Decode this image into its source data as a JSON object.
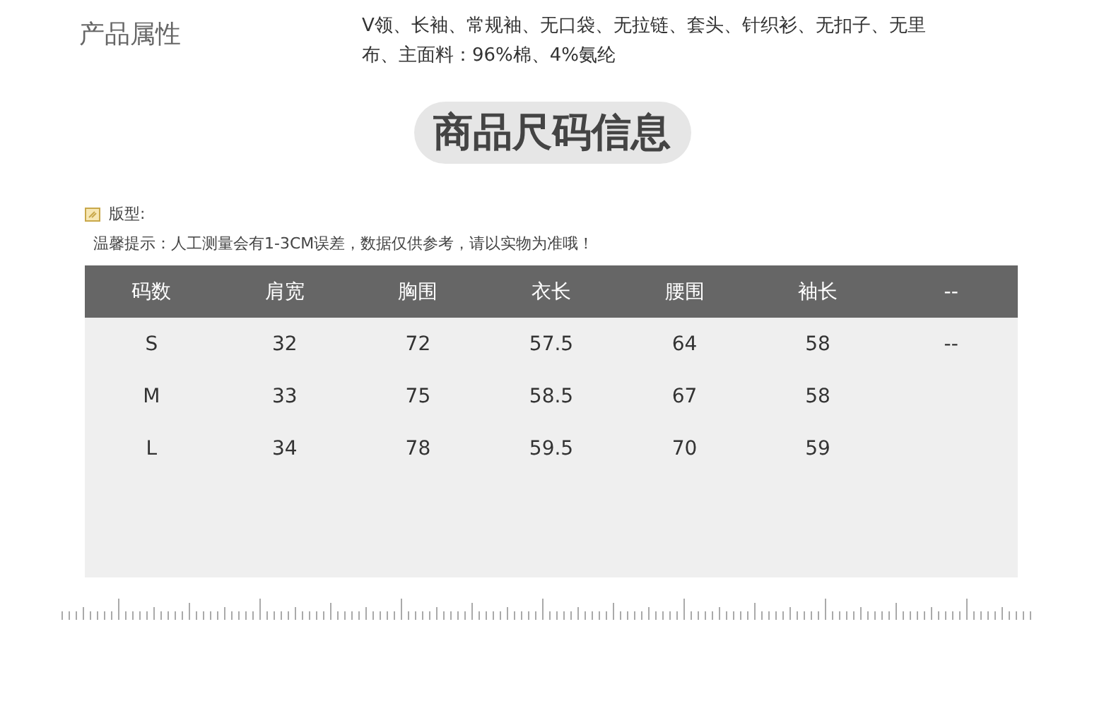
{
  "attributes": {
    "label": "产品属性",
    "value": "V领、长袖、常规袖、无口袋、无拉链、套头、针织衫、无扣子、无里布、主面料：96%棉、4%氨纶"
  },
  "section_title": "商品尺码信息",
  "fit": {
    "label": "版型:"
  },
  "notice": "温馨提示：人工测量会有1-3CM误差，数据仅供参考，请以实物为准哦！",
  "table": {
    "columns": [
      "码数",
      "肩宽",
      "胸围",
      "衣长",
      "腰围",
      "袖长",
      "--"
    ],
    "rows": [
      [
        "S",
        "32",
        "72",
        "57.5",
        "64",
        "58",
        "--"
      ],
      [
        "M",
        "33",
        "75",
        "58.5",
        "67",
        "58",
        ""
      ],
      [
        "L",
        "34",
        "78",
        "59.5",
        "70",
        "59",
        ""
      ]
    ]
  }
}
